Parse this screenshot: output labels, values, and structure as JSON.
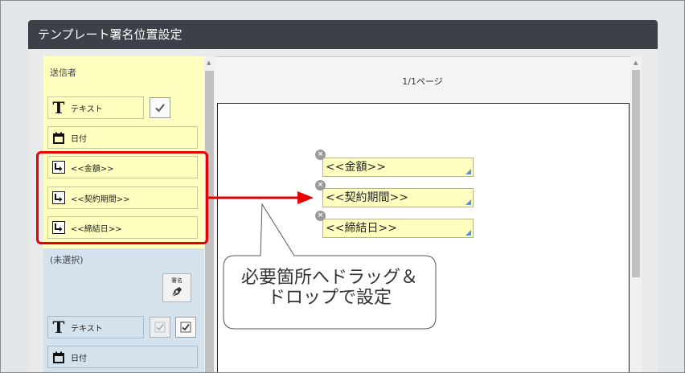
{
  "dialog": {
    "title": "テンプレート署名位置設定"
  },
  "left_panel": {
    "sender_section": {
      "label": "送信者",
      "text_field": {
        "label": "テキスト",
        "icon": "text-t-icon"
      },
      "date_field": {
        "label": "日付",
        "icon": "calendar-icon"
      },
      "template_fields": [
        {
          "label": "<<金額>>",
          "icon": "arrow-insert-icon"
        },
        {
          "label": "<<契約期間>>",
          "icon": "arrow-insert-icon"
        },
        {
          "label": "<<締結日>>",
          "icon": "arrow-insert-icon"
        }
      ]
    },
    "unselected_section": {
      "label": "(未選択)",
      "signature_button_label": "署名",
      "text_field": {
        "label": "テキスト",
        "icon": "text-t-icon"
      },
      "date_field": {
        "label": "日付",
        "icon": "calendar-icon"
      }
    }
  },
  "document": {
    "page_indicator": "1/1ページ",
    "placed_fields": [
      {
        "label": "<<金額>>"
      },
      {
        "label": "<<契約期間>>"
      },
      {
        "label": "<<締結日>>"
      }
    ]
  },
  "annotation": {
    "callout_line1": "必要箇所へドラッグ＆",
    "callout_line2": "ドロップで設定",
    "highlight_color": "#e60000"
  },
  "colors": {
    "header_bg": "#3c4048",
    "sender_bg": "#ffffc0",
    "unselected_bg": "#d4e2ee",
    "resize_handle": "#5b8fd0"
  }
}
